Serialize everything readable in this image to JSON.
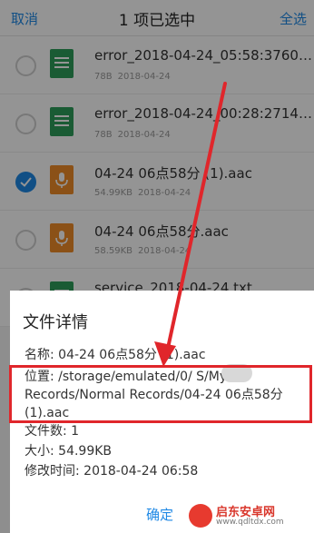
{
  "topbar": {
    "cancel": "取消",
    "title": "1 项已选中",
    "select_all": "全选"
  },
  "files": [
    {
      "name": "error_2018-04-24_05:58:37602...",
      "size": "78B",
      "date": "2018-04-24",
      "type": "txt",
      "selected": false
    },
    {
      "name": "error_2018-04-24_00:28:27140...",
      "size": "78B",
      "date": "2018-04-24",
      "type": "txt",
      "selected": false
    },
    {
      "name": "04-24 06点58分 (1).aac",
      "size": "54.99KB",
      "date": "2018-04-24",
      "type": "aac",
      "selected": true
    },
    {
      "name": "04-24 06点58分.aac",
      "size": "58.59KB",
      "date": "2018-04-24",
      "type": "aac",
      "selected": false
    },
    {
      "name": "service_2018-04-24.txt",
      "size": "",
      "date": "",
      "type": "txt",
      "selected": false
    }
  ],
  "dialog": {
    "title": "文件详情",
    "name_line": "名称: 04-24 06点58分 (1).aac",
    "location_lines": [
      "位置: /storage/emulated/0/     S/My",
      "Records/Normal Records/04-24 06点58分",
      "(1).aac"
    ],
    "file_count": "文件数: 1",
    "size": "大小: 54.99KB",
    "modified": "修改时间: 2018-04-24 06:58",
    "ok": "确定"
  },
  "watermark": {
    "name": "启东安卓网",
    "url": "www.qdltdx.com"
  },
  "colors": {
    "accent": "#1e88e5",
    "annotation": "#e0262b",
    "txt_icon": "#2e9e5b",
    "aac_icon": "#f08c28"
  },
  "icons": {
    "txt": "text-file-icon",
    "aac": "microphone-icon",
    "check": "check-icon"
  }
}
